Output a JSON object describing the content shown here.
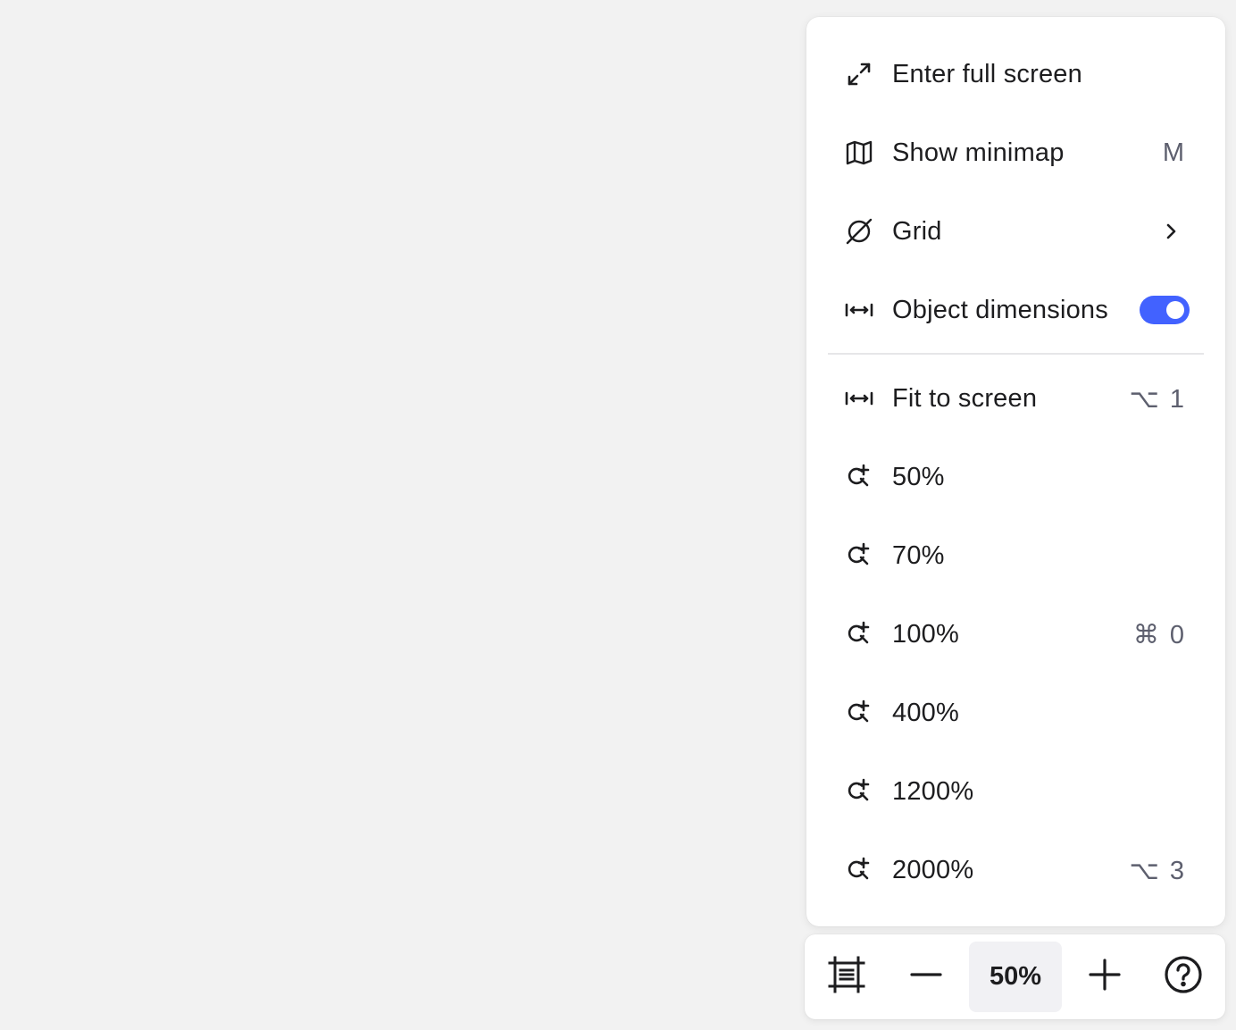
{
  "menu": {
    "items": [
      {
        "id": "fullscreen",
        "label": "Enter full screen",
        "shortcut": "",
        "icon": "expand-arrows-icon"
      },
      {
        "id": "minimap",
        "label": "Show minimap",
        "shortcut": "M",
        "icon": "map-icon"
      },
      {
        "id": "grid",
        "label": "Grid",
        "shortcut": "",
        "icon": "grid-off-icon"
      },
      {
        "id": "dimensions",
        "label": "Object dimensions",
        "shortcut": "",
        "icon": "dimension-icon",
        "toggle": true
      },
      {
        "id": "fit",
        "label": "Fit to screen",
        "shortcut": "⌥ 1",
        "icon": "dimension-icon"
      },
      {
        "id": "z50",
        "label": "50%",
        "shortcut": "",
        "icon": "zoom-in-icon"
      },
      {
        "id": "z70",
        "label": "70%",
        "shortcut": "",
        "icon": "zoom-in-icon"
      },
      {
        "id": "z100",
        "label": "100%",
        "shortcut": "⌘ 0",
        "icon": "zoom-in-icon"
      },
      {
        "id": "z400",
        "label": "400%",
        "shortcut": "",
        "icon": "zoom-in-icon"
      },
      {
        "id": "z1200",
        "label": "1200%",
        "shortcut": "",
        "icon": "zoom-in-icon"
      },
      {
        "id": "z2000",
        "label": "2000%",
        "shortcut": "⌥ 3",
        "icon": "zoom-in-icon"
      }
    ]
  },
  "toolbar": {
    "zoom_level": "50%",
    "buttons": [
      "frame-icon",
      "zoom-out-icon",
      "zoom-in-plus-icon",
      "help-icon"
    ]
  },
  "colors": {
    "accent": "#4262ff",
    "background": "#f2f2f2",
    "panel": "#ffffff",
    "shortcut_text": "#5d5f6e"
  }
}
